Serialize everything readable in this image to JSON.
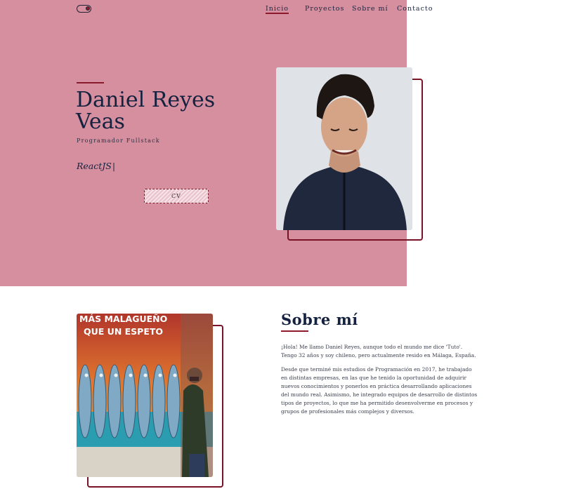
{
  "nav": {
    "items": [
      {
        "label": "Inicio",
        "active": true
      },
      {
        "label": "Proyectos",
        "active": false
      },
      {
        "label": "Sobre mí",
        "active": false
      },
      {
        "label": "Contacto",
        "active": false
      }
    ]
  },
  "theme_toggle": {
    "icon": "toggle-switch-icon"
  },
  "hero": {
    "name": "Daniel Reyes Veas",
    "role": "Programador Fullstack",
    "typed_text": "ReactJS",
    "cursor": "|",
    "cv_label": "CV"
  },
  "about": {
    "title": "Sobre mí",
    "paragraph1": "¡Hola! Me llamo Daniel Reyes, aunque todo el mundo me dice 'Tuto'. Tengo 32 años y soy chileno, pero actualmente resido en Málaga, España.",
    "paragraph2": "Desde que terminé mis estudios de Programación en 2017, he trabajado en distintas empresas, en las que he tenido la oportunidad de adquirir nuevos conocimientos y ponerlos en práctica desarrollando aplicaciones del mundo real. Asimismo, he integrado equipos de desarrollo de distintos tipos de proyectos, lo que me ha permitido desenvolverme en procesos y grupos de profesionales más complejos y diversos.",
    "photo_caption_line1": "MÁS MALAGUEÑO",
    "photo_caption_line2": "QUE UN ESPETO"
  },
  "colors": {
    "hero_bg": "#d58f9f",
    "accent": "#8b1a2c",
    "text": "#15223f"
  }
}
